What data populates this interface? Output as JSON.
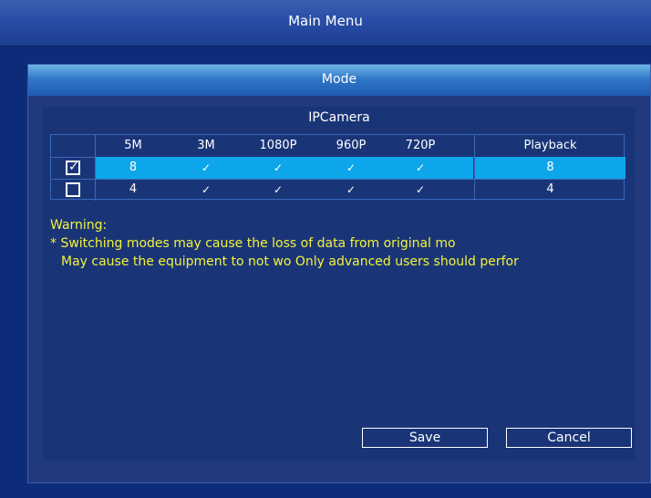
{
  "main_menu": {
    "title": "Main Menu"
  },
  "mode_window": {
    "title": "Mode",
    "section_title": "IPCamera",
    "columns": [
      "5M",
      "3M",
      "1080P",
      "960P",
      "720P",
      "Playback"
    ],
    "rows": [
      {
        "checked": true,
        "check_symbol": "✓",
        "5M": "8",
        "3M": "✓",
        "1080P": "✓",
        "960P": "✓",
        "720P": "✓",
        "playback": "8"
      },
      {
        "checked": false,
        "check_symbol": "",
        "5M": "4",
        "3M": "✓",
        "1080P": "✓",
        "960P": "✓",
        "720P": "✓",
        "playback": "4"
      }
    ],
    "warning": {
      "label": "Warning:",
      "line1": "* Switching modes may cause the loss of data from original mo",
      "line2": "May cause the equipment to not wo Only advanced users should perfor"
    },
    "buttons": {
      "save": "Save",
      "cancel": "Cancel"
    }
  },
  "colors": {
    "highlight": "#0ea6ea",
    "warning": "#f3f23b",
    "panel": "#1a3577"
  }
}
